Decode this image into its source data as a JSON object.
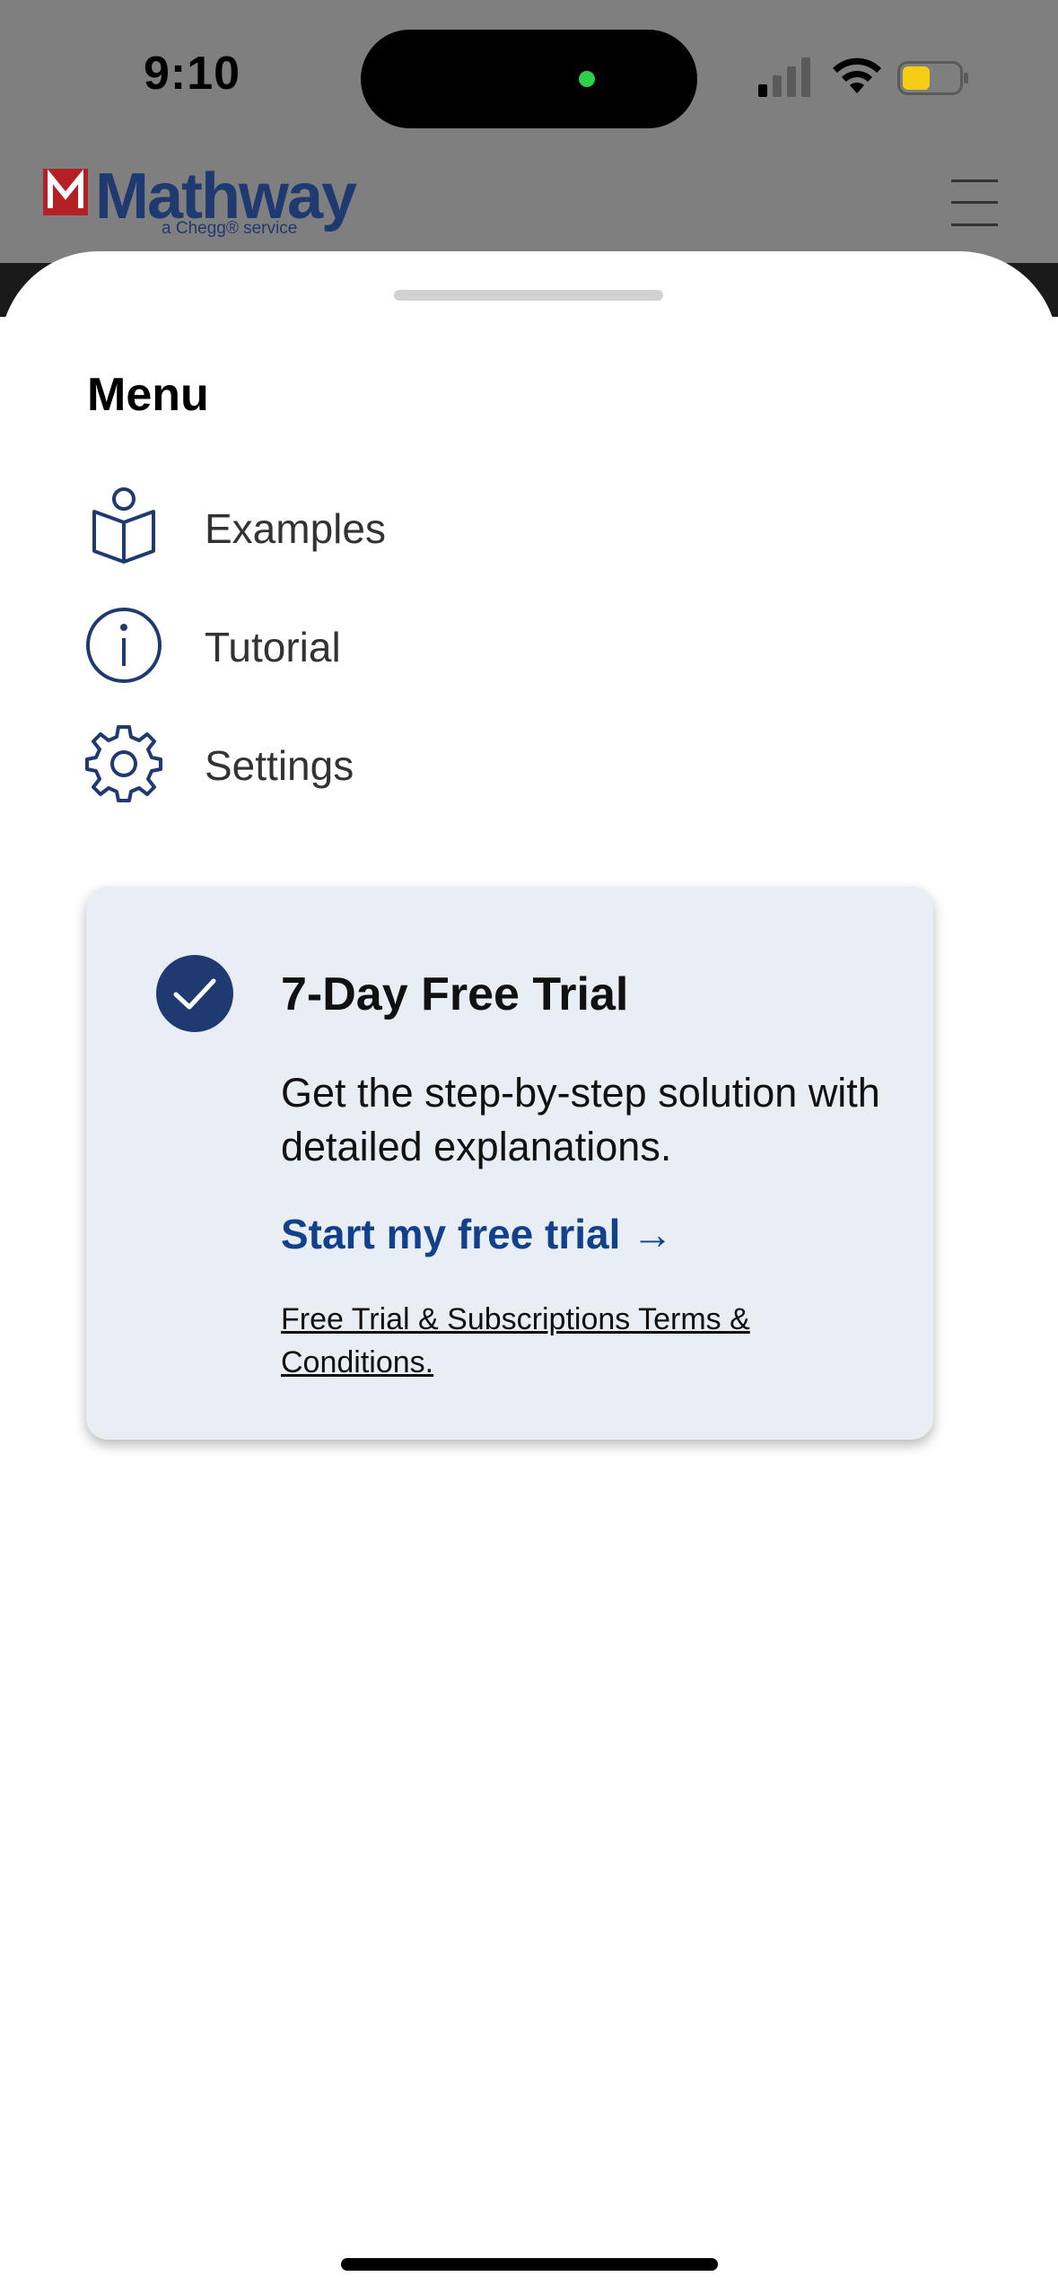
{
  "status_bar": {
    "time": "9:10"
  },
  "background_page": {
    "logo_text": "Mathway",
    "logo_subtext": "a Chegg® service"
  },
  "sheet": {
    "title": "Menu",
    "items": [
      {
        "label": "Examples",
        "icon": "book-reader-icon"
      },
      {
        "label": "Tutorial",
        "icon": "info-icon"
      },
      {
        "label": "Settings",
        "icon": "gear-icon"
      }
    ]
  },
  "trial": {
    "title": "7-Day Free Trial",
    "description": "Get the step-by-step solution with detailed explanations.",
    "cta": "Start my free trial →",
    "terms": "Free Trial & Subscriptions Terms & Conditions."
  },
  "colors": {
    "accent": "#1f3a70",
    "link": "#13408a",
    "card_bg": "#e9eef5"
  }
}
